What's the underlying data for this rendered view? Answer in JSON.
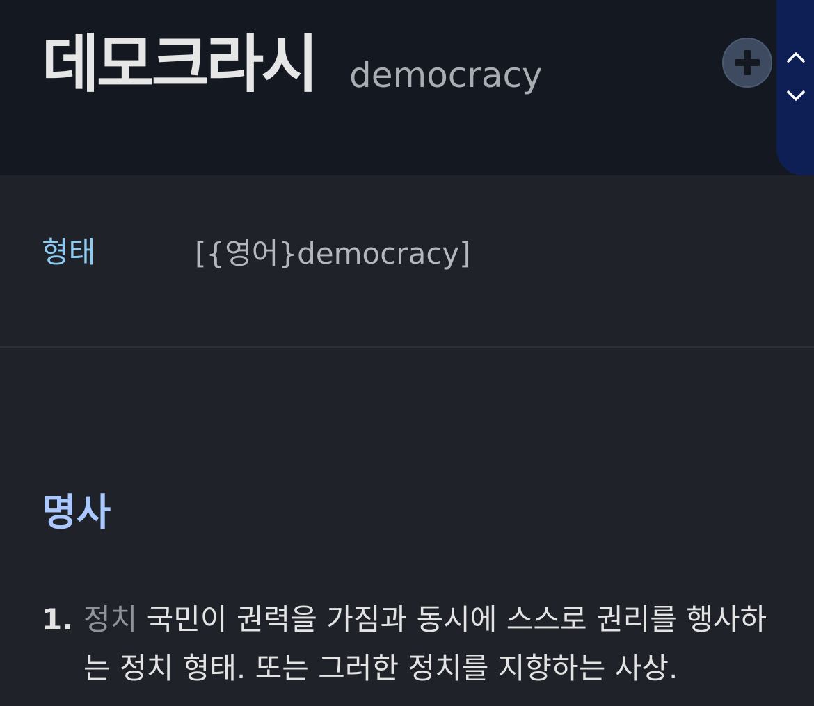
{
  "entry": {
    "headword": "데모크라시",
    "romanized": "democracy"
  },
  "header_actions": {
    "add_icon": "plus-circle-icon",
    "up_icon": "chevron-up-icon",
    "down_icon": "chevron-down-icon"
  },
  "form_row": {
    "label": "형태",
    "value": "[{영어}democracy]"
  },
  "part_of_speech": "명사",
  "senses": [
    {
      "number": "1.",
      "field": "정치",
      "definition": "국민이 권력을 가짐과 동시에 스스로 권리를 행사하는 정치 형태. 또는 그러한 정치를 지향하는 사상."
    }
  ],
  "colors": {
    "header_bg": "#141820",
    "body_bg": "#1f2228",
    "nav_panel": "#0d1f54",
    "form_label": "#8ecbf2",
    "pos_label": "#aac8ff"
  }
}
